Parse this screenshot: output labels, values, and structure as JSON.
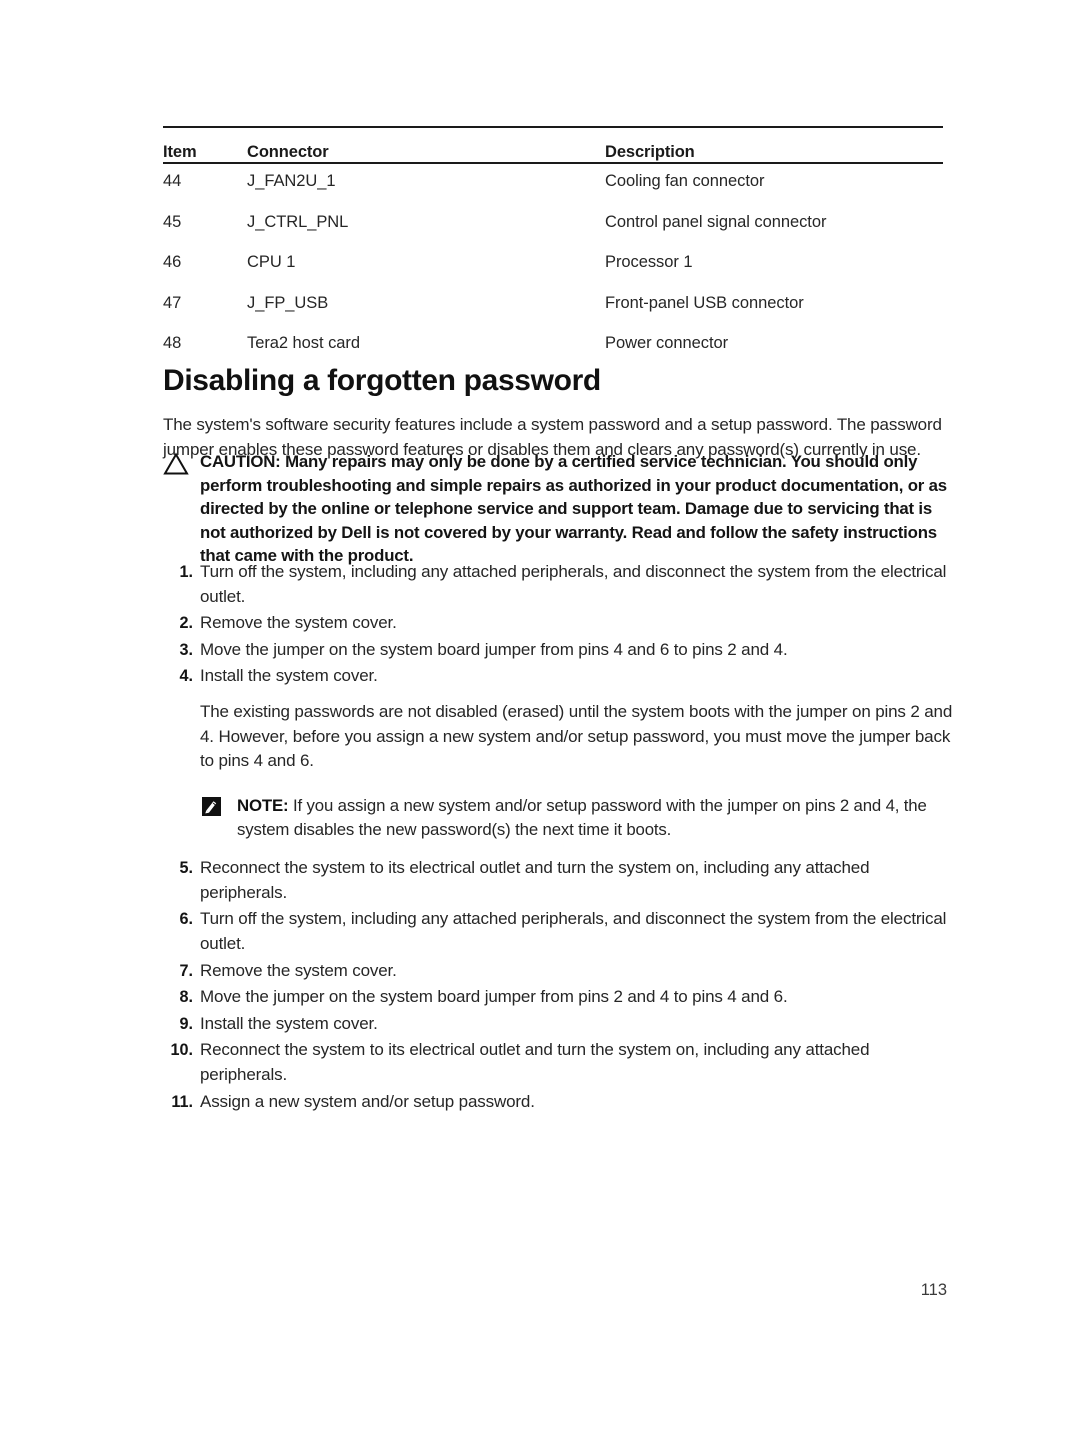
{
  "table": {
    "headers": [
      "Item",
      "Connector",
      "Description"
    ],
    "rows": [
      {
        "item": "44",
        "connector": "J_FAN2U_1",
        "description": "Cooling fan connector"
      },
      {
        "item": "45",
        "connector": "J_CTRL_PNL",
        "description": "Control panel signal connector"
      },
      {
        "item": "46",
        "connector": "CPU 1",
        "description": "Processor 1"
      },
      {
        "item": "47",
        "connector": "J_FP_USB",
        "description": "Front-panel USB connector"
      },
      {
        "item": "48",
        "connector": "Tera2 host card",
        "description": "Power connector"
      }
    ]
  },
  "heading": "Disabling a forgotten password",
  "intro": "The system's software security features include a system password and a setup password. The password jumper enables these password features or disables them and clears any password(s) currently in use.",
  "caution": {
    "icon": "warning-triangle-icon",
    "text": "CAUTION: Many repairs may only be done by a certified service technician. You should only perform troubleshooting and simple repairs as authorized in your product documentation, or as directed by the online or telephone service and support team. Damage due to servicing that is not authorized by Dell is not covered by your warranty. Read and follow the safety instructions that came with the product."
  },
  "steps": [
    {
      "num": "1.",
      "text": "Turn off the system, including any attached peripherals, and disconnect the system from the electrical outlet."
    },
    {
      "num": "2.",
      "text": "Remove the system cover."
    },
    {
      "num": "3.",
      "text": "Move the jumper on the system board jumper from pins 4 and 6 to pins 2 and 4."
    },
    {
      "num": "4.",
      "text": "Install the system cover."
    },
    {
      "num": "5.",
      "text": "Reconnect the system to its electrical outlet and turn the system on, including any attached peripherals."
    },
    {
      "num": "6.",
      "text": "Turn off the system, including any attached peripherals, and disconnect the system from the electrical outlet."
    },
    {
      "num": "7.",
      "text": "Remove the system cover."
    },
    {
      "num": "8.",
      "text": "Move the jumper on the system board jumper from pins 2 and 4 to pins 4 and 6."
    },
    {
      "num": "9.",
      "text": "Install the system cover."
    },
    {
      "num": "10.",
      "text": "Reconnect the system to its electrical outlet and turn the system on, including any attached peripherals."
    },
    {
      "num": "11.",
      "text": "Assign a new system and/or setup password."
    }
  ],
  "after_step_four": {
    "paragraph": "The existing passwords are not disabled (erased) until the system boots with the jumper on pins 2 and 4. However, before you assign a new system and/or setup password, you must move the jumper back to pins 4 and 6.",
    "note": {
      "icon": "note-pencil-icon",
      "label": "NOTE:",
      "text": " If you assign a new system and/or setup password with the jumper on pins 2 and 4, the system disables the new password(s) the next time it boots."
    }
  },
  "page_number": "113",
  "colors": {
    "text": "#262626",
    "rule": "#1a1a1a"
  }
}
